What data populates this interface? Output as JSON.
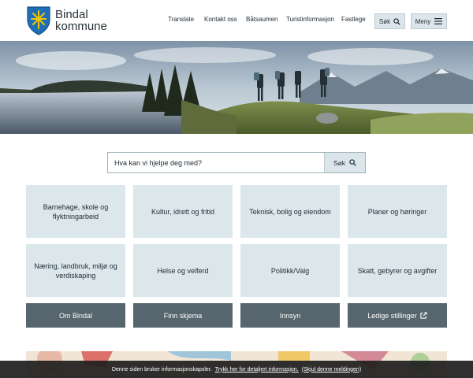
{
  "brand": {
    "line1": "Bindal",
    "line2": "kommune"
  },
  "nav": {
    "items": [
      "Translate",
      "Kontakt oss",
      "Båtsaumen",
      "Turistinformasjon",
      "Fastlege"
    ],
    "search_label": "Søk",
    "menu_label": "Meny"
  },
  "search": {
    "placeholder": "Hva kan vi hjelpe deg med?",
    "button_label": "Søk"
  },
  "tiles": [
    "Barnehage, skole og flyktningarbeid",
    "Kultur, idrett og fritid",
    "Teknisk, bolig og eiendom",
    "Planer og høringer",
    "Næring, landbruk, miljø og verdiskaping",
    "Helse og velferd",
    "Politikk/Valg",
    "Skatt, gebyrer og avgifter"
  ],
  "quick_links": [
    "Om Bindal",
    "Finn skjema",
    "Innsyn",
    "Ledige stillinger"
  ],
  "cookie": {
    "text": "Denne siden bruker informasjonskapsler.",
    "link_info": "Trykk her for detaljert informasjon.",
    "link_hide": "(Skjul denne meldingen)"
  },
  "icons": {
    "search": "search-icon",
    "menu": "hamburger-icon",
    "external": "external-link-icon",
    "logo": "coat-of-arms-icon"
  },
  "colors": {
    "tile_bg": "#dce7eb",
    "dark_tile_bg": "#56656e",
    "logo_blue": "#1f6fb8",
    "logo_yellow": "#f2c500"
  }
}
